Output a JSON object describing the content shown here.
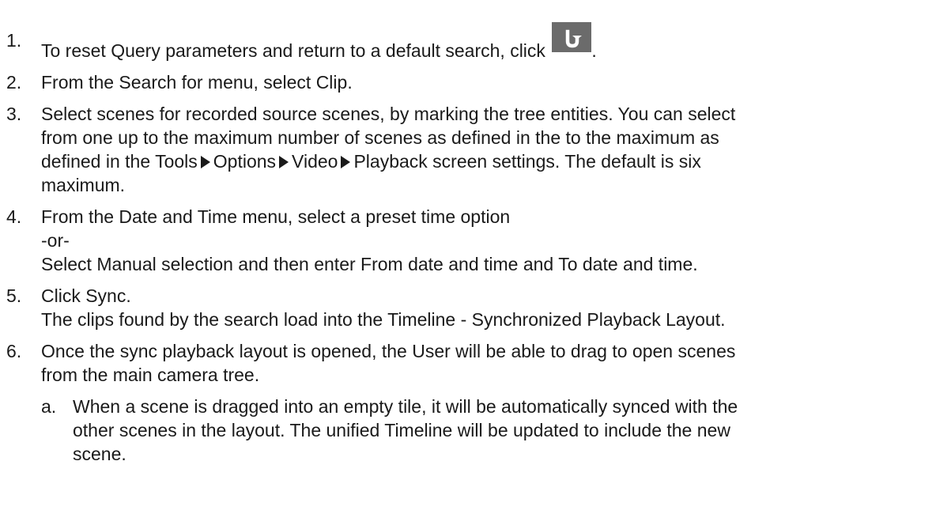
{
  "steps": [
    {
      "num": "1.",
      "text_before_icon": "To reset Query parameters and return to a default search, click",
      "icon": "refresh-reset-icon",
      "text_after_icon": "."
    },
    {
      "num": "2.",
      "text": "From the Search for menu, select Clip."
    },
    {
      "num": "3.",
      "line1": "Select scenes for recorded source scenes, by marking the tree entities. You can select",
      "line2": "from one up to the maximum number of scenes as defined in the to the maximum as",
      "line3_start": "defined in the Tools",
      "menu_path": [
        "Options",
        "Video",
        "Playback"
      ],
      "line3_end": " screen settings. The default is six",
      "line4": "maximum."
    },
    {
      "num": "4.",
      "line1": "From the Date and Time menu, select a preset time option",
      "line2": "-or-",
      "line3": "Select Manual selection and then enter From date and time and To date and time."
    },
    {
      "num": "5.",
      "line1": "Click Sync.",
      "line2": "The clips found by the search load into the Timeline - Synchronized Playback Layout."
    },
    {
      "num": "6.",
      "line1": "Once the sync playback layout is opened, the User will be able to drag to open scenes",
      "line2": "from the main camera tree.",
      "substeps": [
        {
          "num": "a.",
          "line1": "When a scene is dragged into an empty tile, it will be automatically synced with the",
          "line2": "other scenes in the layout. The unified Timeline will be updated to include the new",
          "line3": "scene."
        }
      ]
    }
  ],
  "colors": {
    "text": "#1a1a1a",
    "icon_bg": "#6b6b6b",
    "icon_fg": "#ffffff"
  }
}
